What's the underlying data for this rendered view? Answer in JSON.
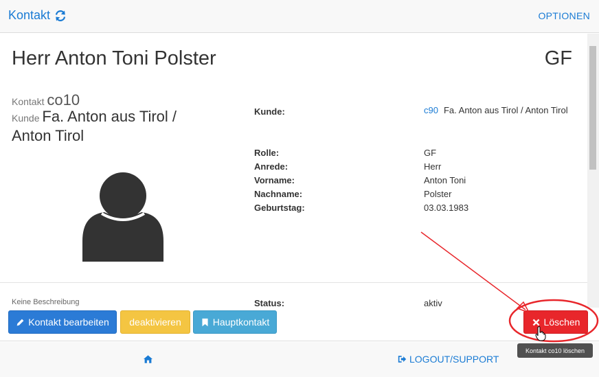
{
  "header": {
    "title": "Kontakt",
    "refresh_icon": "refresh-icon",
    "options_label": "OPTIONEN"
  },
  "contact": {
    "full_name": "Herr Anton Toni Polster",
    "role_short": "GF",
    "contact_label": "Kontakt",
    "contact_id": "co10",
    "customer_label": "Kunde",
    "customer_name": "Fa. Anton aus Tirol / Anton Tirol",
    "avatar_icon": "user-avatar-icon"
  },
  "details": {
    "kunde_label": "Kunde:",
    "kunde_link": "c90",
    "kunde_value": "Fa. Anton aus Tirol / Anton Tirol",
    "rolle_label": "Rolle:",
    "rolle_value": "GF",
    "anrede_label": "Anrede:",
    "anrede_value": "Herr",
    "vorname_label": "Vorname:",
    "vorname_value": "Anton Toni",
    "nachname_label": "Nachname:",
    "nachname_value": "Polster",
    "geburtstag_label": "Geburtstag:",
    "geburtstag_value": "03.03.1983",
    "description": "Keine Beschreibung",
    "status_label": "Status:",
    "status_value": "aktiv"
  },
  "actions": {
    "edit_label": "Kontakt bearbeiten",
    "deactivate_label": "deaktivieren",
    "main_contact_label": "Hauptkontakt",
    "delete_label": "Löschen",
    "delete_tooltip": "Kontakt co10 löschen"
  },
  "footer": {
    "logout_label": "LOGOUT/SUPPORT"
  },
  "colors": {
    "link": "#1a7bd4",
    "edit_button": "#2b7bd6",
    "deactivate_button": "#f4c542",
    "main_contact_button": "#49a9d6",
    "delete_button": "#e8262b",
    "annotation": "#e8262b"
  }
}
